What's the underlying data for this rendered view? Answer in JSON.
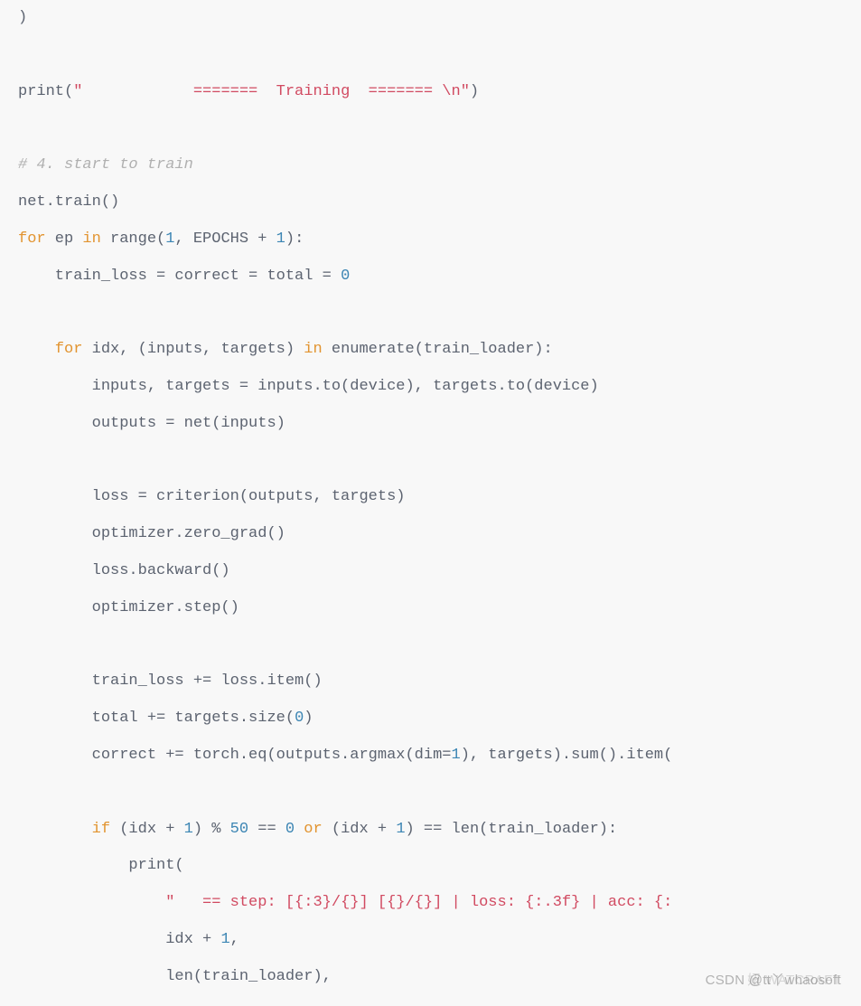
{
  "code": {
    "line01": ")",
    "line02_a": "print(",
    "line02_b": "\"            =======  Training  ======= \\n\"",
    "line02_c": ")",
    "line03": "# 4. start to train",
    "line04": "net.train()",
    "line05_a": "for",
    "line05_b": " ep ",
    "line05_c": "in",
    "line05_d": " range(",
    "line05_e": "1",
    "line05_f": ", EPOCHS + ",
    "line05_g": "1",
    "line05_h": "):",
    "line06_a": "    train_loss = correct = total = ",
    "line06_b": "0",
    "line07_a": "    for",
    "line07_b": " idx, (inputs, targets) ",
    "line07_c": "in",
    "line07_d": " enumerate(train_loader):",
    "line08": "        inputs, targets = inputs.to(device), targets.to(device)",
    "line09": "        outputs = net(inputs)",
    "line10": "        loss = criterion(outputs, targets)",
    "line11": "        optimizer.zero_grad()",
    "line12": "        loss.backward()",
    "line13": "        optimizer.step()",
    "line14": "        train_loss += loss.item()",
    "line15_a": "        total += targets.size(",
    "line15_b": "0",
    "line15_c": ")",
    "line16_a": "        correct += torch.eq(outputs.argmax(dim=",
    "line16_b": "1",
    "line16_c": "), targets).sum().item(",
    "line17_a": "        if",
    "line17_b": " (idx + ",
    "line17_c": "1",
    "line17_d": ") % ",
    "line17_e": "50",
    "line17_f": " == ",
    "line17_g": "0",
    "line17_h": " or",
    "line17_i": " (idx + ",
    "line17_j": "1",
    "line17_k": ") == len(train_loader):",
    "line18": "            print(",
    "line19": "\"   == step: [{:3}/{}] [{}/{}] | loss: {:.3f} | acc: {:",
    "line20_a": "                idx + ",
    "line20_b": "1",
    "line20_c": ",",
    "line21": "                len(train_loader),"
  },
  "watermark1": "CSDN @tt丫whaosoft",
  "watermark2": "妞 WATCRAFT"
}
